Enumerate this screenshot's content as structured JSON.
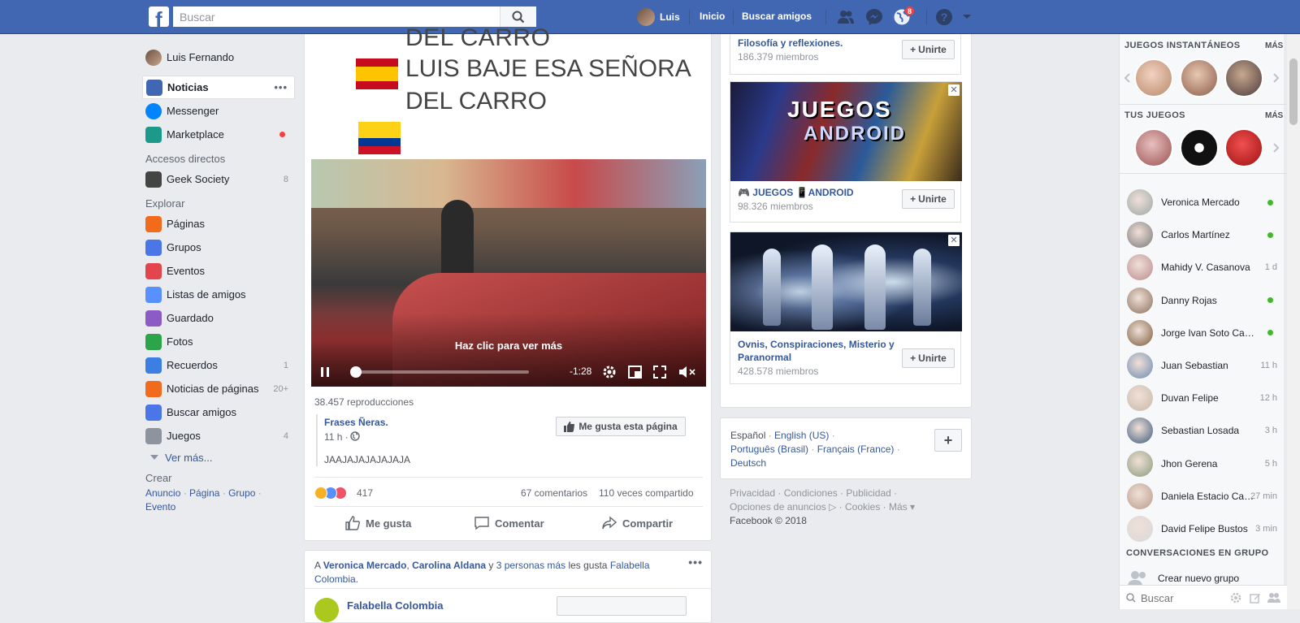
{
  "topbar": {
    "search_placeholder": "Buscar",
    "user_name": "Luis",
    "home_label": "Inicio",
    "find_friends_label": "Buscar amigos",
    "notifications_count": "8"
  },
  "leftnav": {
    "profile_name": "Luis Fernando",
    "main_items": [
      {
        "label": "Noticias",
        "icon": "news-feed-icon",
        "color": "#4267b2"
      },
      {
        "label": "Messenger",
        "icon": "messenger-icon",
        "color": "#0084ff"
      },
      {
        "label": "Marketplace",
        "icon": "marketplace-icon",
        "color": "#1b9a8a"
      }
    ],
    "shortcuts_heading": "Accesos directos",
    "shortcuts": [
      {
        "label": "Geek Society",
        "count": "8"
      }
    ],
    "explore_heading": "Explorar",
    "explore_items": [
      {
        "label": "Páginas",
        "count": "",
        "color": "#f26b1d"
      },
      {
        "label": "Grupos",
        "count": "",
        "color": "#4a76e8"
      },
      {
        "label": "Eventos",
        "count": "",
        "color": "#e4444c"
      },
      {
        "label": "Listas de amigos",
        "count": "",
        "color": "#5890ff"
      },
      {
        "label": "Guardado",
        "count": "",
        "color": "#8c5bc5"
      },
      {
        "label": "Fotos",
        "count": "",
        "color": "#2ba44a"
      },
      {
        "label": "Recuerdos",
        "count": "1",
        "color": "#3b7fe3"
      },
      {
        "label": "Noticias de páginas",
        "count": "20+",
        "color": "#f26b1d"
      },
      {
        "label": "Buscar amigos",
        "count": "",
        "color": "#4a76e8"
      },
      {
        "label": "Juegos",
        "count": "4",
        "color": "#8d949e"
      }
    ],
    "see_more": "Ver más...",
    "create_heading": "Crear",
    "create_links": [
      "Anuncio",
      "Página",
      "Grupo",
      "Evento"
    ]
  },
  "post": {
    "meme_line_top": "DEL CARRO",
    "meme_line_1": "LUIS BAJE ESA SEÑORA",
    "meme_line_2": "DEL CARRO",
    "video_cta": "Haz clic para ver más",
    "video_time": "-1:28",
    "video_progress": 0.02,
    "views": "38.457 reproducciones",
    "page_name": "Frases Ñeras.",
    "page_time": "11 h ·",
    "like_page_button": "Me gusta esta página",
    "post_text": "JAAJAJAJAJAJAJA",
    "reactions_count": "417",
    "comments": "67 comentarios",
    "shares": "110 veces compartido",
    "actions": [
      "Me gusta",
      "Comentar",
      "Compartir"
    ]
  },
  "post2": {
    "prefix": "A",
    "friend1": "Veronica Mercado",
    "sep": ",",
    "friend2": "Carolina Aldana",
    "and": "y",
    "others": "3 personas más",
    "liked": "les gusta",
    "page": "Falabella Colombia",
    "page_line2_end": ".",
    "author": "Falabella Colombia"
  },
  "groups": [
    {
      "name": "Filosofía y reflexiones.",
      "members": "186.379 miembros",
      "join": "Unirte"
    },
    {
      "name": "🎮 JUEGOS 📱ANDROID",
      "members": "98.326 miembros",
      "join": "Unirte"
    },
    {
      "name": "Ovnis, Conspiraciones, Misterio y Paranormal",
      "members": "428.578 miembros",
      "join": "Unirte"
    }
  ],
  "languages": {
    "current": "Español",
    "options": [
      "English (US)",
      "Português (Brasil)",
      "Français (France)",
      "Deutsch"
    ]
  },
  "footer": {
    "links": [
      "Privacidad",
      "Condiciones",
      "Publicidad",
      "Opciones de anuncios",
      "Cookies",
      "Más"
    ],
    "copyright": "Facebook © 2018"
  },
  "chat": {
    "instant_games_title": "JUEGOS INSTANTÁNEOS",
    "more": "MÁS",
    "your_games_title": "TUS JUEGOS",
    "contacts": [
      {
        "name": "Veronica Mercado",
        "status": "",
        "online": true,
        "color": "#9aa7a6"
      },
      {
        "name": "Carlos Martínez",
        "status": "",
        "online": true,
        "color": "#777"
      },
      {
        "name": "Mahidy V. Casanova",
        "status": "1 d",
        "online": false,
        "color": "#b98b8b"
      },
      {
        "name": "Danny Rojas",
        "status": "",
        "online": true,
        "color": "#8a6e5a"
      },
      {
        "name": "Jorge Ivan Soto Castro",
        "status": "",
        "online": true,
        "color": "#7a5a3a"
      },
      {
        "name": "Juan Sebastian",
        "status": "11 h",
        "online": false,
        "color": "#6a8ab0"
      },
      {
        "name": "Duvan Felipe",
        "status": "12 h",
        "online": false,
        "color": "#c8b8a8"
      },
      {
        "name": "Sebastian Losada",
        "status": "3 h",
        "online": false,
        "color": "#3a5a7a"
      },
      {
        "name": "Jhon Gerena",
        "status": "5 h",
        "online": false,
        "color": "#8a9a7a"
      },
      {
        "name": "Daniela Estacio Campo",
        "status": "27 min",
        "online": false,
        "color": "#b89a88"
      },
      {
        "name": "David Felipe Bustos",
        "status": "3 min",
        "online": false,
        "color": "#d8d8d8"
      }
    ],
    "group_conversations_title": "CONVERSACIONES EN GRUPO",
    "create_group": "Crear nuevo grupo",
    "search_placeholder": "Buscar"
  }
}
